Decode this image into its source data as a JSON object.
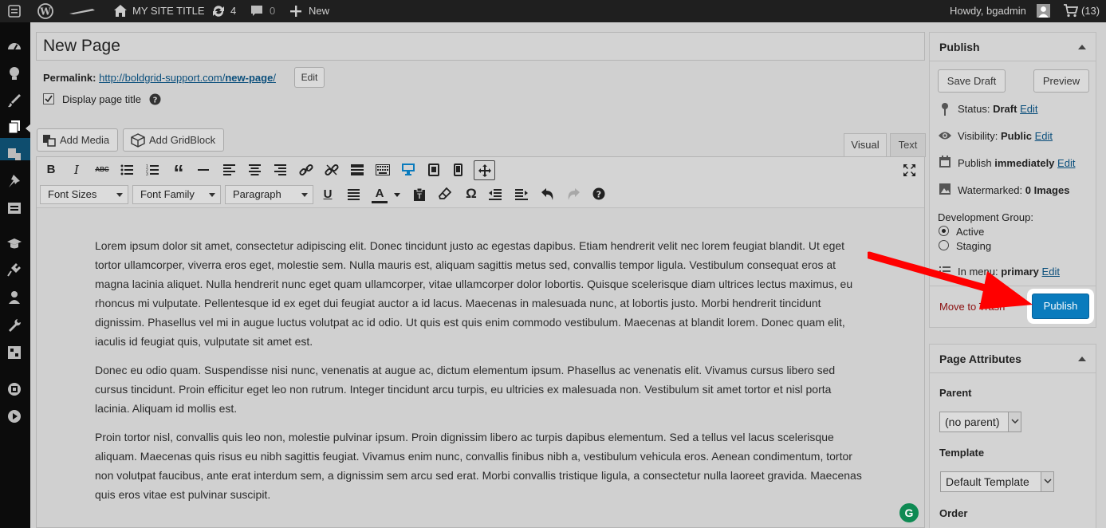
{
  "adminbar": {
    "site_title": "MY SITE TITLE",
    "updates_count": "4",
    "comments_count": "0",
    "new_label": "New",
    "howdy": "Howdy, bgadmin",
    "cart_count": "(13)"
  },
  "editor": {
    "page_title": "New Page",
    "permalink_label": "Permalink:",
    "permalink_url": "http://boldgrid-support.com/",
    "permalink_slug": "new-page",
    "permalink_trailing": "/",
    "edit_label": "Edit",
    "display_title_label": "Display page title",
    "add_media": "Add Media",
    "add_gridblock": "Add GridBlock",
    "tab_visual": "Visual",
    "tab_text": "Text",
    "font_sizes": "Font Sizes",
    "font_family": "Font Family",
    "paragraph": "Paragraph",
    "paragraphs": [
      "Lorem ipsum dolor sit amet, consectetur adipiscing elit. Donec tincidunt justo ac egestas dapibus. Etiam hendrerit velit nec lorem feugiat blandit. Ut eget tortor ullamcorper, viverra eros eget, molestie sem. Nulla mauris est, aliquam sagittis metus sed, convallis tempor ligula. Vestibulum consequat eros at magna lacinia aliquet. Nulla hendrerit nunc eget quam ullamcorper, vitae ullamcorper dolor lobortis. Quisque scelerisque diam ultrices lectus maximus, eu rhoncus mi vulputate. Pellentesque id ex eget dui feugiat auctor a id lacus. Maecenas in malesuada nunc, at lobortis justo. Morbi hendrerit tincidunt dignissim. Phasellus vel mi in augue luctus volutpat ac id odio. Ut quis est quis enim commodo vestibulum. Maecenas at blandit lorem. Donec quam elit, iaculis id feugiat quis, vulputate sit amet est.",
      "Donec eu odio quam. Suspendisse nisi nunc, venenatis at augue ac, dictum elementum ipsum. Phasellus ac venenatis elit. Vivamus cursus libero sed cursus tincidunt. Proin efficitur eget leo non rutrum. Integer tincidunt arcu turpis, eu ultricies ex malesuada non. Vestibulum sit amet tortor et nisl porta lacinia. Aliquam id mollis est.",
      "Proin tortor nisl, convallis quis leo non, molestie pulvinar ipsum. Proin dignissim libero ac turpis dapibus elementum. Sed a tellus vel lacus scelerisque aliquam. Maecenas quis risus eu nibh sagittis feugiat. Vivamus enim nunc, convallis finibus nibh a, vestibulum vehicula eros. Aenean condimentum, tortor non volutpat faucibus, ante erat interdum sem, a dignissim sem arcu sed erat. Morbi convallis tristique ligula, a consectetur nulla laoreet gravida. Maecenas quis eros vitae est pulvinar suscipit."
    ],
    "grammarly": "G"
  },
  "publish_box": {
    "title": "Publish",
    "save_draft": "Save Draft",
    "preview": "Preview",
    "status_label": "Status:",
    "status_value": "Draft",
    "visibility_label": "Visibility:",
    "visibility_value": "Public",
    "publish_label": "Publish",
    "publish_value": "immediately",
    "watermarked_label": "Watermarked:",
    "watermarked_value": "0 Images",
    "dev_group_label": "Development Group:",
    "dev_group_options": [
      "Active",
      "Staging"
    ],
    "dev_group_selected": "Active",
    "in_menu_label": "In menu:",
    "in_menu_value": "primary",
    "edit": "Edit",
    "move_to_trash": "Move to Trash",
    "publish_button": "Publish"
  },
  "page_attributes": {
    "title": "Page Attributes",
    "parent_label": "Parent",
    "parent_value": "(no parent)",
    "template_label": "Template",
    "template_value": "Default Template",
    "order_label": "Order"
  },
  "colors": {
    "publish_blue": "#0a7bbd",
    "trash_red": "#8b0f0f",
    "arrow_red": "#ff0000",
    "link_blue": "#0b4f7c",
    "active_menu": "#0e4d6e"
  }
}
